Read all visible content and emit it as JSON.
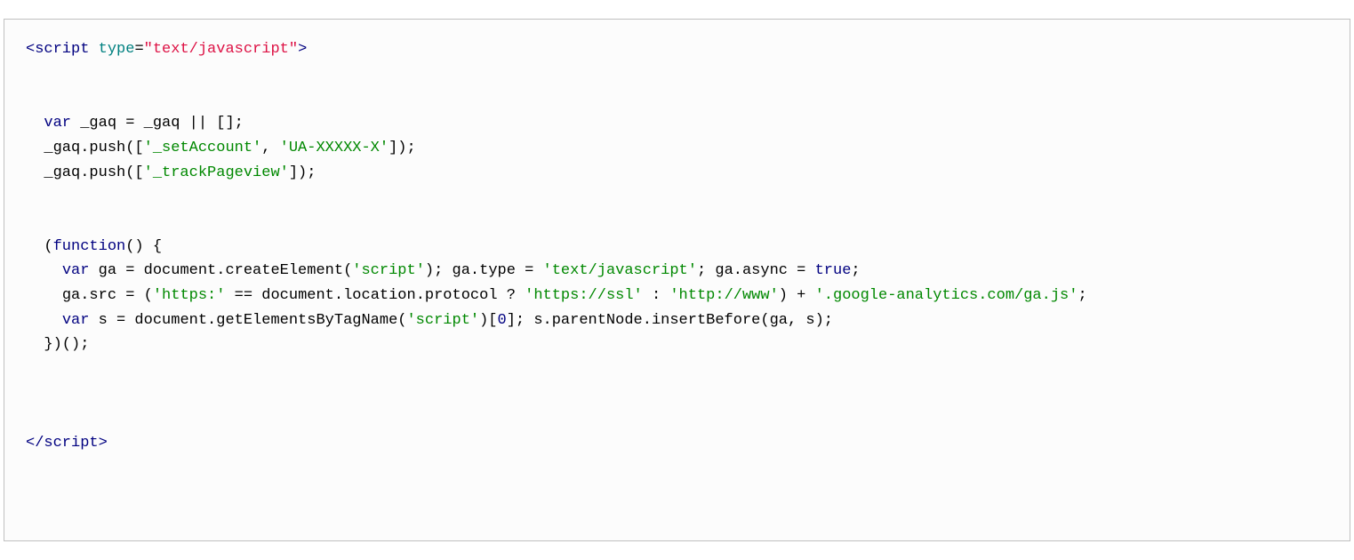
{
  "code": {
    "open_tag_lt": "<",
    "open_tag_name": "script",
    "attr_type_name": "type",
    "eq": "=",
    "attr_type_val": "\"text/javascript\"",
    "open_tag_gt": ">",
    "close_tag_lt": "</",
    "close_tag_name": "script",
    "close_tag_gt": ">",
    "var_kw": "var",
    "gaq_decl": " _gaq = _gaq || [];",
    "push1_pre": "  _gaq.push([",
    "str_setAccount": "'_setAccount'",
    "push1_mid": ", ",
    "str_ua": "'UA-XXXXX-X'",
    "push1_post": "]);",
    "push2_pre": "  _gaq.push([",
    "str_trackPageview": "'_trackPageview'",
    "push2_post": "]);",
    "iife_open": "  (",
    "function_kw": "function",
    "iife_head": "() {",
    "ga_decl_post": " ga = document.createElement(",
    "str_script": "'script'",
    "ga_type_pre": "); ga.type = ",
    "str_textjs": "'text/javascript'",
    "ga_async_pre": "; ga.async = ",
    "bool_true": "true",
    "semi": ";",
    "src_pre": "    ga.src = (",
    "str_https": "'https:'",
    "src_eq": " == document.location.protocol ? ",
    "str_ssl": "'https://ssl'",
    "src_colon": " : ",
    "str_www": "'http://www'",
    "src_plus": ") + ",
    "str_gaurl": "'.google-analytics.com/ga.js'",
    "s_decl_post": " s = document.getElementsByTagName(",
    "s_idx_pre": ")[",
    "num_zero": "0",
    "s_idx_post": "]; s.parentNode.insertBefore(ga, s);",
    "iife_close": "  })();"
  }
}
